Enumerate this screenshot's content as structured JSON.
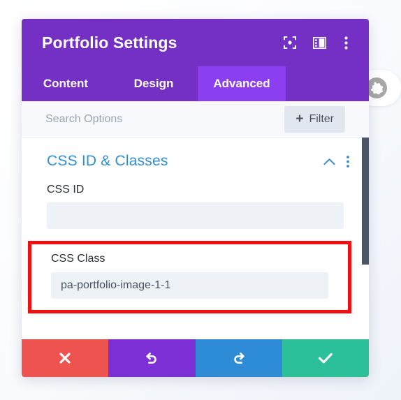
{
  "background": {
    "globe_icon": "globe-icon"
  },
  "header": {
    "title": "Portfolio Settings",
    "icons": [
      {
        "name": "focus-target-icon"
      },
      {
        "name": "layout-panel-icon"
      },
      {
        "name": "vertical-dots-icon"
      }
    ]
  },
  "tabs": [
    {
      "label": "Content",
      "active": false
    },
    {
      "label": "Design",
      "active": false
    },
    {
      "label": "Advanced",
      "active": true
    }
  ],
  "search": {
    "placeholder": "Search Options",
    "value": "",
    "filter_label": "Filter",
    "filter_plus": "+"
  },
  "section": {
    "title": "CSS ID & Classes",
    "collapse_icon": "chevron-up-icon",
    "menu_icon": "vertical-dots-icon"
  },
  "fields": [
    {
      "label": "CSS ID",
      "value": "",
      "placeholder": "",
      "highlighted": false
    },
    {
      "label": "CSS Class",
      "value": "pa-portfolio-image-1-1",
      "placeholder": "",
      "highlighted": true
    }
  ],
  "footer": [
    {
      "name": "cancel-button",
      "icon": "close-icon",
      "color": "#ef5350"
    },
    {
      "name": "undo-button",
      "icon": "undo-icon",
      "color": "#7c2fd4"
    },
    {
      "name": "redo-button",
      "icon": "redo-icon",
      "color": "#2e8bd6"
    },
    {
      "name": "save-button",
      "icon": "checkmark-icon",
      "color": "#2bbf9a"
    }
  ],
  "colors": {
    "header_purple": "#7430c4",
    "active_tab_purple": "#8c3ff0",
    "section_blue": "#2f8fd4",
    "highlight_red": "#ee1111",
    "scrollbar": "#4a5568"
  }
}
